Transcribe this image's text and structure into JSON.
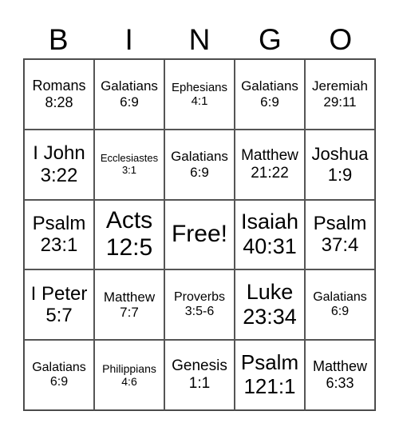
{
  "header": [
    "B",
    "I",
    "N",
    "G",
    "O"
  ],
  "cells": [
    [
      "Romans",
      "8:28"
    ],
    [
      "Galatians",
      "6:9"
    ],
    [
      "Ephesians",
      "4:1"
    ],
    [
      "Galatians",
      "6:9"
    ],
    [
      "Jeremiah",
      "29:11"
    ],
    [
      "I John",
      "3:22"
    ],
    [
      "Ecclesiastes",
      "3:1"
    ],
    [
      "Galatians",
      "6:9"
    ],
    [
      "Matthew",
      "21:22"
    ],
    [
      "Joshua",
      "1:9"
    ],
    [
      "Psalm",
      "23:1"
    ],
    [
      "Acts",
      "12:5"
    ],
    [
      "Free!",
      ""
    ],
    [
      "Isaiah",
      "40:31"
    ],
    [
      "Psalm",
      "37:4"
    ],
    [
      "I Peter",
      "5:7"
    ],
    [
      "Matthew",
      "7:7"
    ],
    [
      "Proverbs",
      "3:5-6"
    ],
    [
      "Luke",
      "23:34"
    ],
    [
      "Galatians",
      "6:9"
    ],
    [
      "Galatians",
      "6:9"
    ],
    [
      "Philippians",
      "4:6"
    ],
    [
      "Genesis",
      "1:1"
    ],
    [
      "Psalm",
      "121:1"
    ],
    [
      "Matthew",
      "6:33"
    ]
  ]
}
